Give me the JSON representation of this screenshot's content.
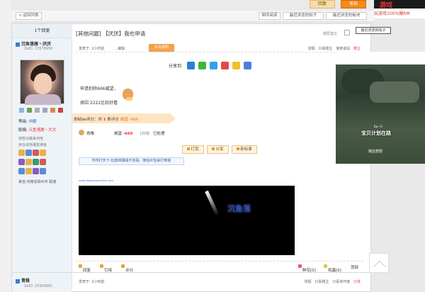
{
  "top": {
    "reply_btn": "回复",
    "post_btn": "发帖"
  },
  "top_ad": {
    "title": "游戏",
    "subtitle": "玩游戏100%爆RM"
  },
  "nav": {
    "back": "< 返回列表",
    "prev": "倒序阅读",
    "recent": "最近浏览的帖子",
    "recent2": "最近浏览的板块"
  },
  "side": {
    "reply_count": "1个回复",
    "user1": {
      "name": "沉鱼落雁丶厌厌",
      "id": "ZelD: 23576950"
    },
    "rank_label": "等级:",
    "rank_value": "中尉",
    "award_label": "配偶:",
    "award_value": "沉鱼落雁丶犬犬",
    "stat1": "存款马路来何地",
    "stat2": "存在线地潮雷沸各",
    "from": "来自:河南省郑州市 联通",
    "user2": {
      "name": "青稚",
      "id": "ZelD: 25958961"
    }
  },
  "post": {
    "category": "[其他问题]",
    "title": "【厌厌】我也申请",
    "view_toggle": "楼层直达",
    "tooltip": "最近浏览的帖子",
    "time": "发表于: 2小时前",
    "edit": ", 编辑",
    "badge": "补充说明",
    "ops": [
      "举报",
      "只看楼主",
      "使用道具"
    ],
    "op_floor": "楼主",
    "share_label": "分享到",
    "line1": "申请扣除666威望，",
    "line2": "原因 2222比较好看",
    "rating": {
      "prefix": "本帖de评分：共",
      "count": "1",
      "suffix": "条评分",
      "weiwang": "威望 -666"
    },
    "rate_row": {
      "name": "青稚",
      "key": "威望",
      "value": "-666",
      "time": "1秒前",
      "status": "已处理"
    },
    "actions": [
      "打赏",
      "分享",
      "新标事"
    ],
    "sig": "传传打天下-玩游戏赚钱不容易，微信红包来打到我",
    "link": "www.ufaeoaproduction.com",
    "video_text": "沉鱼落",
    "bottom": {
      "reply": "回复",
      "quote": "引用",
      "rate": "评分",
      "flower": "鲜花[0]",
      "egg": "鸡蛋[0]",
      "top": "顶部"
    }
  },
  "post2": {
    "time": "发表于: 2小时前",
    "ops": [
      "举报",
      "只看楼主",
      "只看该作者"
    ],
    "floor": "沙发"
  },
  "ad": {
    "cap0": "Ep—0",
    "cap1": "宝贝计划在路",
    "cap2": "我还想想"
  },
  "colors": {
    "accent": "#f48a1a",
    "rank": "#1a5fb4",
    "alert": "#e33333"
  }
}
